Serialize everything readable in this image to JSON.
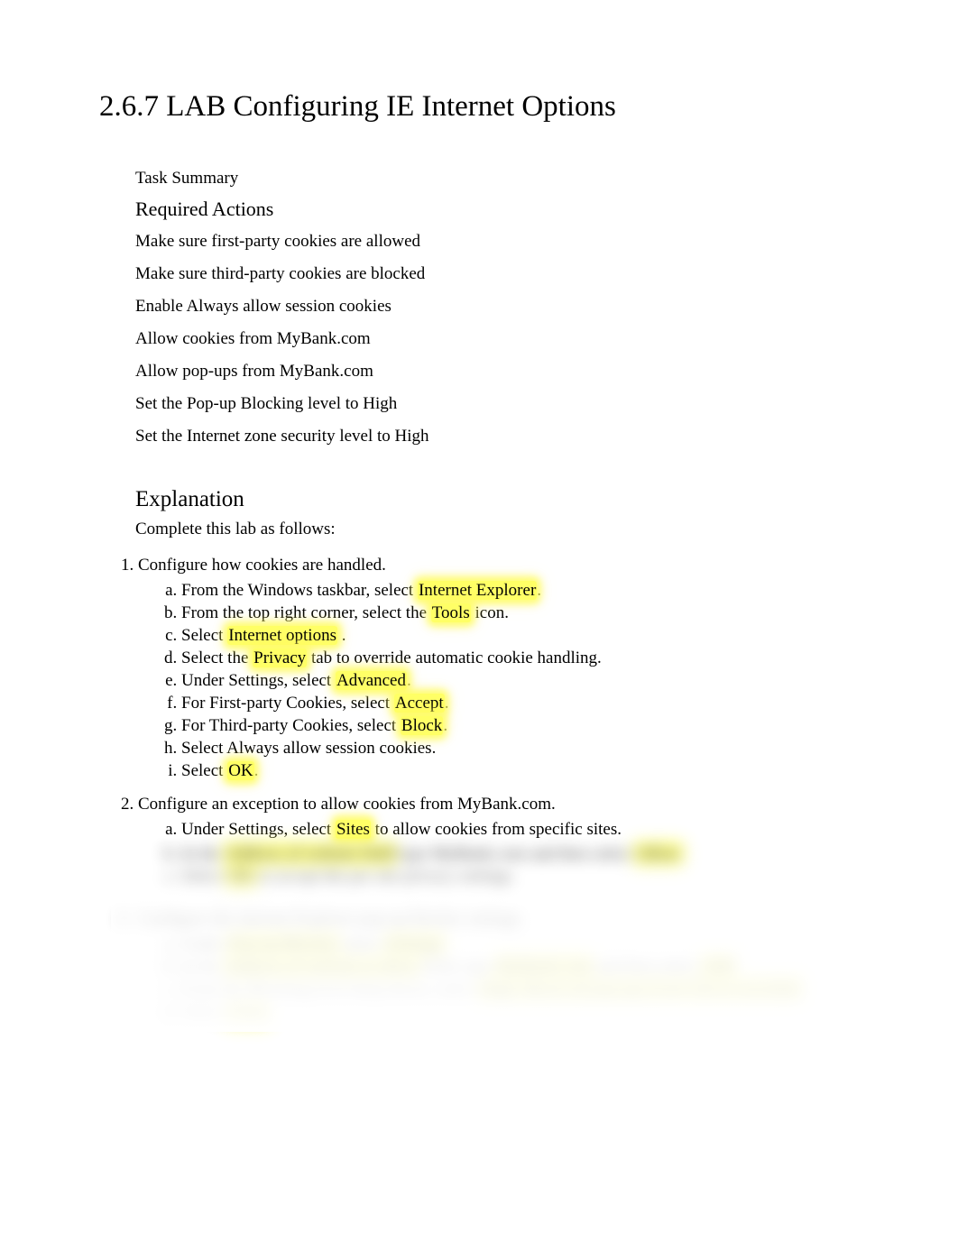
{
  "title": "2.6.7 LAB Configuring IE Internet Options",
  "taskSummary": "Task Summary",
  "requiredActions": "Required Actions",
  "actions": [
    "Make sure first-party cookies are allowed",
    "Make sure third-party cookies are blocked",
    "Enable Always allow session cookies",
    "Allow cookies from MyBank.com",
    "Allow pop-ups from MyBank.com",
    "Set the Pop-up Blocking level to High",
    "Set the Internet zone security level to High"
  ],
  "explanation": {
    "header": "Explanation",
    "intro": "Complete this lab as follows:",
    "step1": {
      "title": "Configure how cookies are handled.",
      "a_pre": "From the Windows taskbar, select ",
      "a_hl": "Internet Explorer",
      "a_post": ".",
      "b_pre": "From the top right corner, select the ",
      "b_hl": "Tools",
      "b_post": " icon.",
      "c_pre": "Select ",
      "c_hl": "Internet options",
      "c_post": " .",
      "d_pre": "Select the ",
      "d_hl": "Privacy",
      "d_post": " tab to override automatic cookie handling.",
      "e_pre": "Under Settings, select ",
      "e_hl": "Advanced",
      "e_post": ".",
      "f_pre": "For First-party Cookies, select ",
      "f_hl": "Accept",
      "f_post": ".",
      "g_pre": "For Third-party Cookies, select ",
      "g_hl": "Block",
      "g_post": ".",
      "h": "Select Always allow session cookies.",
      "i_pre": "Select ",
      "i_hl": "OK",
      "i_post": "."
    },
    "step2": {
      "title": "Configure an exception to allow cookies from MyBank.com.",
      "a_pre": "Under Settings, select ",
      "a_hl": "Sites",
      "a_post": " to allow cookies from specific sites.",
      "b_visible": "b.",
      "b_blur_pre": "In the ",
      "b_blur_hl1": "Address of website field",
      "b_blur_mid": " type MyBank.com and then select ",
      "b_blur_hl2": "Allow",
      "c_blur_pre": "Select ",
      "c_blur_hl": "OK",
      "c_blur_post": " to accept the per site privacy settings."
    },
    "step3_blur": {
      "title": "Configure the internet Explorer pop-up blocker settings.",
      "a_pre": "Under ",
      "a_hl1": "Pop-up Blocker",
      "a_mid": " select ",
      "a_hl2": "Settings",
      "b_pre": "In the ",
      "b_hl1": "Address of website to allow",
      "b_mid": " field, type ",
      "b_hl2": "MyBank.com",
      "b_mid2": " and then select ",
      "b_hl3": "Add",
      "c_pre": "From the Blocking level drop-down, select ",
      "c_hl": "High: Block all pop-ups (Ctrl+Alt to override)",
      "d_pre": "Select ",
      "d_hl": "Close"
    }
  }
}
